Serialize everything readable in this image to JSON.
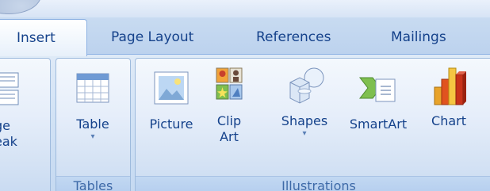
{
  "tabs": [
    {
      "label": "Insert",
      "active": true
    },
    {
      "label": "Page Layout",
      "active": false
    },
    {
      "label": "References",
      "active": false
    },
    {
      "label": "Mailings",
      "active": false
    }
  ],
  "groups": {
    "pages": {
      "page_break_line1": "ge",
      "page_break_line2": "eak"
    },
    "tables": {
      "label": "Tables",
      "table_button": "Table",
      "table_arrow": "▾"
    },
    "illustrations": {
      "label": "Illustrations",
      "picture": "Picture",
      "clip_art_line1": "Clip",
      "clip_art_line2": "Art",
      "shapes": "Shapes",
      "shapes_arrow": "▾",
      "smartart": "SmartArt",
      "chart": "Chart"
    }
  },
  "colors": {
    "tab_text": "#15428b",
    "group_label_text": "#3e6aa8",
    "ribbon_bg": "#d3e3f5"
  }
}
